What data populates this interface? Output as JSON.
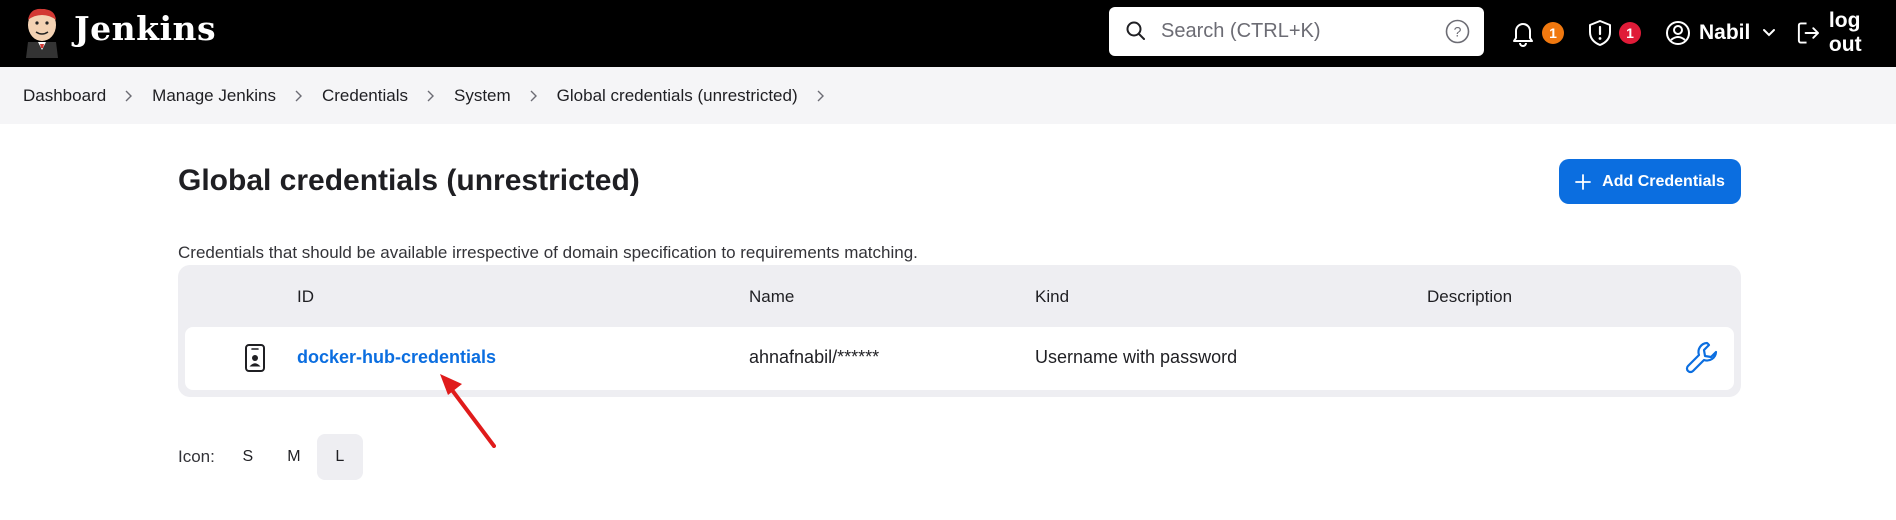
{
  "header": {
    "brand": "Jenkins",
    "search": {
      "placeholder": "Search (CTRL+K)"
    },
    "notifications_count": "1",
    "security_count": "1",
    "user_name": "Nabil",
    "logout_label": "log out",
    "colors": {
      "notification_badge": "#f0780f",
      "security_badge": "#e01b38",
      "background": "#000000"
    }
  },
  "breadcrumb": [
    {
      "label": "Dashboard"
    },
    {
      "label": "Manage Jenkins"
    },
    {
      "label": "Credentials"
    },
    {
      "label": "System"
    },
    {
      "label": "Global credentials (unrestricted)"
    }
  ],
  "main": {
    "title": "Global credentials (unrestricted)",
    "add_button_label": "Add Credentials",
    "description": "Credentials that should be available irrespective of domain specification to requirements matching.",
    "table": {
      "columns": [
        "ID",
        "Name",
        "Kind",
        "Description"
      ],
      "rows": [
        {
          "id": "docker-hub-credentials",
          "name": "ahnafnabil/******",
          "kind": "Username with password",
          "description": ""
        }
      ]
    },
    "icon_size": {
      "label": "Icon:",
      "options": [
        "S",
        "M",
        "L"
      ],
      "selected": "L"
    }
  },
  "accent_color": "#0b6ee0"
}
